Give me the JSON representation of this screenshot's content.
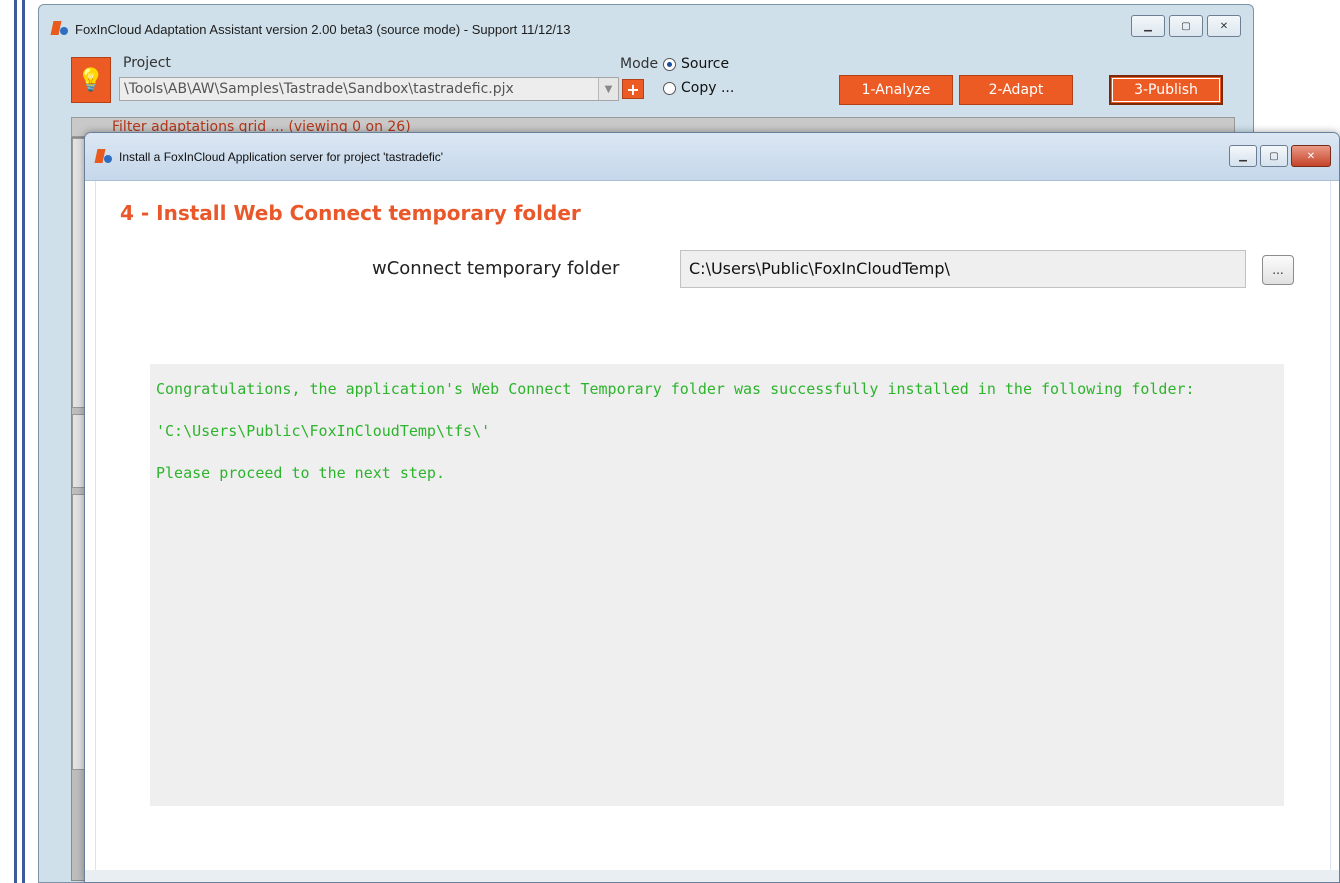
{
  "back_window": {
    "title": "FoxInCloud Adaptation Assistant version 2.00 beta3 (source mode) - Support 11/12/13",
    "project_label": "Project",
    "project_value": "\\Tools\\AB\\AW\\Samples\\Tastrade\\Sandbox\\tastradefic.pjx",
    "add_label": "+",
    "mode_label": "Mode",
    "mode_options": [
      "Source",
      "Copy ..."
    ],
    "mode_selected": "Source",
    "buttons": {
      "analyze": "1-Analyze",
      "adapt": "2-Adapt",
      "publish": "3-Publish"
    },
    "filter_text": "Filter adaptations grid ... (viewing 0 on 26)",
    "window_controls": [
      "minimize",
      "maximize",
      "close"
    ]
  },
  "dialog": {
    "title": "Install a FoxInCloud Application server for project 'tastradefic'",
    "step_title": "4 - Install Web Connect temporary folder",
    "field_label": "wConnect temporary folder",
    "field_value": "C:\\Users\\Public\\FoxInCloudTemp\\",
    "browse_label": "...",
    "messages": [
      "Congratulations, the application's Web Connect Temporary folder was successfully installed in the following folder:",
      "'C:\\Users\\Public\\FoxInCloudTemp\\tfs\\'",
      "Please proceed to the next step."
    ],
    "window_controls": [
      "minimize",
      "maximize",
      "close"
    ]
  },
  "colors": {
    "accent": "#ec5b24",
    "message_text": "#2db42d",
    "step_title": "#e9582a"
  }
}
